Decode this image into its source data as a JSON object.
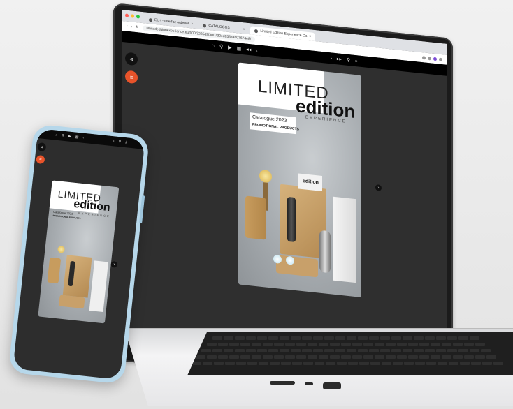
{
  "browser": {
    "tabs": [
      {
        "label": "ELH - Interfaz ordenar",
        "active": false
      },
      {
        "label": "CATALOGOS",
        "active": false
      },
      {
        "label": "Limited Edition Experience Ca",
        "active": true
      }
    ],
    "url": "limitededitionexperience.eu/b00f3285d9f3d0730ed855a4b07674e8/"
  },
  "viewer": {
    "toolbar_icons": [
      "home-icon",
      "zoom-icon",
      "play-icon",
      "grid-icon",
      "first-page-icon",
      "prev-page-icon",
      "next-page-icon",
      "last-page-icon",
      "search-icon",
      "download-icon"
    ],
    "share_icon": "share-icon",
    "menu_icon": "menu-icon",
    "accent": "#e8532a"
  },
  "cover": {
    "limited": "LIMITED",
    "edition": "edition",
    "experience": "EXPERIENCE",
    "catalogue": "Catalogue 2023",
    "promo": "PROMOTIONAL PRODUCTS",
    "box_label": "edition"
  }
}
